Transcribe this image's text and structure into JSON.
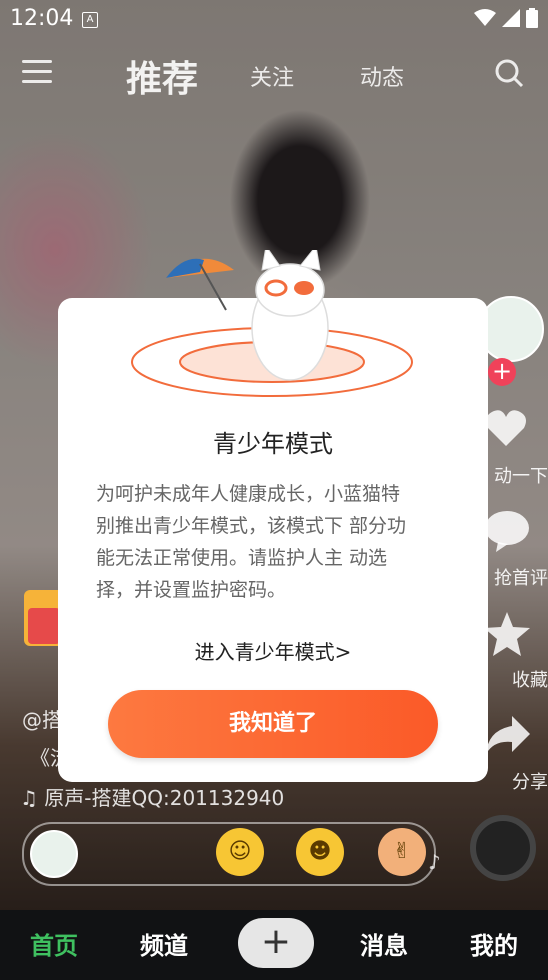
{
  "status_bar": {
    "time": "12:04",
    "notification_letter": "A"
  },
  "top_nav": {
    "tabs": [
      "推荐",
      "关注",
      "动态"
    ],
    "active": "推荐"
  },
  "side_actions": {
    "like": "动一下",
    "comment": "抢首评",
    "favorite": "收藏",
    "share": "分享",
    "plus": "+"
  },
  "captions": {
    "author": "@搭",
    "title": "《流",
    "music": "原声-搭建QQ:201132940"
  },
  "modal": {
    "title": "青少年模式",
    "body_lines": [
      "为呵护未成年人健康成长，小蓝猫特",
      "别推出青少年模式，该模式下 部分功",
      "能无法正常使用。请监护人主 动选",
      "择，并设置监护密码。"
    ],
    "link": "进入青少年模式>",
    "button": "我知道了"
  },
  "bottom_bar": {
    "home": "首页",
    "channel": "频道",
    "add": "+",
    "messages": "消息",
    "mine": "我的",
    "active": "首页"
  },
  "colors": {
    "accent": "#fb5a28",
    "active_tab": "#3fc060"
  }
}
